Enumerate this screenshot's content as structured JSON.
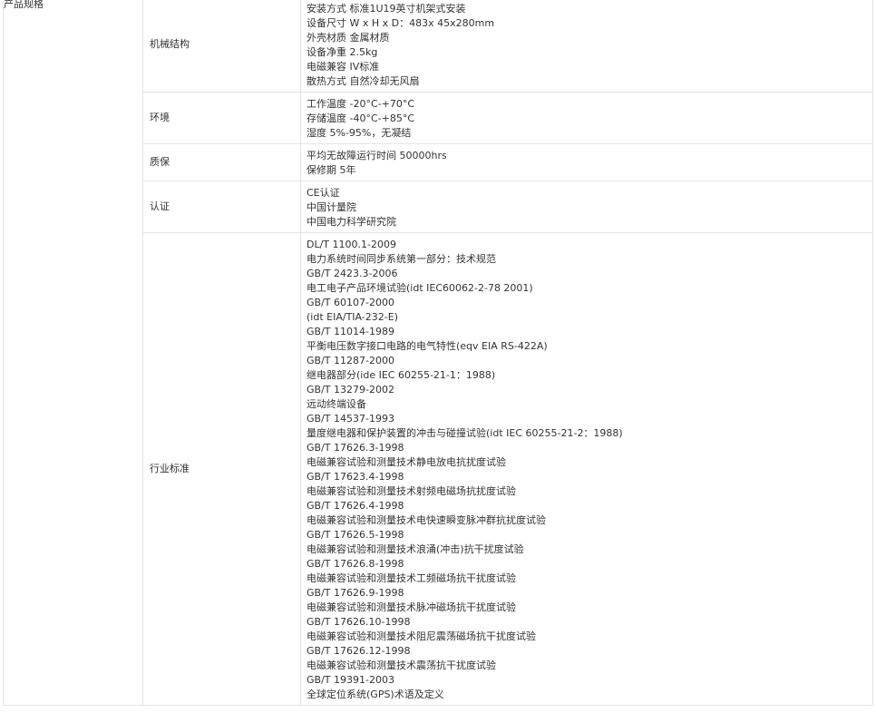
{
  "table": {
    "category": "产品规格",
    "groups": [
      {
        "name": "机械结构",
        "lines": [
          "安装方式 标准1U19英寸机架式安装",
          "设备尺寸 W x H x D：483x 45x280mm",
          "外壳材质 金属材质",
          "设备净重 2.5kg",
          "电磁兼容 IV标准",
          "散热方式 自然冷却无风扇"
        ]
      },
      {
        "name": "环境",
        "lines": [
          "工作温度 -20°C-+70°C",
          "存储温度 -40°C-+85°C",
          "湿度 5%-95%，无凝结"
        ]
      },
      {
        "name": "质保",
        "lines": [
          "平均无故障运行时间 50000hrs",
          "保修期 5年"
        ]
      },
      {
        "name": "认证",
        "lines": [
          "CE认证",
          "中国计量院",
          "中国电力科学研究院"
        ]
      },
      {
        "name": "行业标准",
        "lines": [
          "DL/T 1100.1-2009",
          "电力系统时间同步系统第一部分：技术规范",
          "GB/T 2423.3-2006",
          "电工电子产品环境试验(idt IEC60062-2-78 2001)",
          "GB/T 60107-2000",
          "(idt EIA/TIA-232-E)",
          "GB/T 11014-1989",
          "平衡电压数字接口电路的电气特性(eqv EIA RS-422A)",
          "GB/T 11287-2000",
          "继电器部分(ide IEC 60255-21-1：1988)",
          "GB/T 13279-2002",
          "远动终端设备",
          "GB/T 14537-1993",
          "量度继电器和保护装置的冲击与碰撞试验(idt IEC 60255-21-2：1988)",
          "GB/T 17626.3-1998",
          "电磁兼容试验和测量技术静电放电抗扰度试验",
          "GB/T 17623.4-1998",
          "电磁兼容试验和测量技术射频电磁场抗扰度试验",
          "GB/T 17626.4-1998",
          "电磁兼容试验和测量技术电快速瞬变脉冲群抗扰度试验",
          "GB/T 17626.5-1998",
          "电磁兼容试验和测量技术浪涌(冲击)抗干扰度试验",
          "GB/T 17626.8-1998",
          "电磁兼容试验和测量技术工频磁场抗干扰度试验",
          "GB/T 17626.9-1998",
          "电磁兼容试验和测量技术脉冲磁场抗干扰度试验",
          "GB/T 17626.10-1998",
          "电磁兼容试验和测量技术阻尼震荡磁场抗干扰度试验",
          "GB/T 17626.12-1998",
          "电磁兼容试验和测量技术震荡抗干扰度试验",
          "GB/T 19391-2003",
          "全球定位系统(GPS)术语及定义"
        ]
      }
    ]
  }
}
